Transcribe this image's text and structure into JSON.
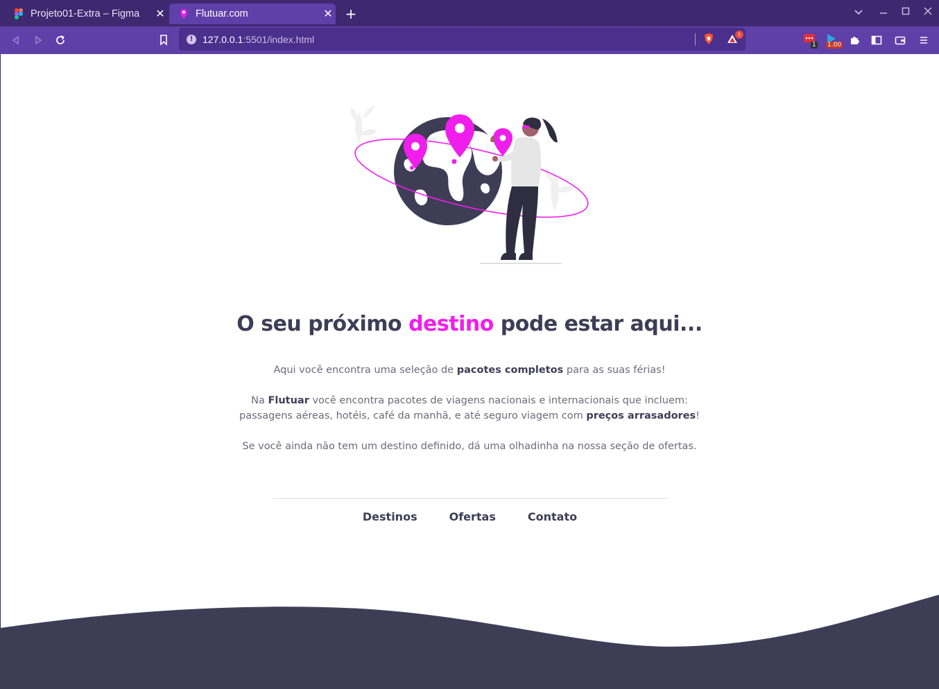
{
  "browser": {
    "tabs": [
      {
        "title": "Projeto01-Extra – Figma",
        "close": "✕",
        "active": false
      },
      {
        "title": "Flutuar.com",
        "close": "✕",
        "active": true
      }
    ],
    "new_tab": "+",
    "window_controls": {
      "dropdown": "⌄",
      "minimize": "–",
      "maximize": "□",
      "close": "✕"
    },
    "url": {
      "host": "127.0.0.1",
      "path": ":5501/index.html"
    },
    "extensions": {
      "alert_badge": "1",
      "ext1_badge": "1",
      "ext2_badge": "1.00"
    },
    "colors": {
      "tabbar": "#3e2870",
      "toolbar": "#5f3fa8",
      "urlbar": "#4a2f8c"
    }
  },
  "page": {
    "headline": {
      "before": "O seu próximo ",
      "accent": "destino",
      "after": " pode estar aqui..."
    },
    "paragraph1": {
      "t1": "Aqui você encontra uma seleção de ",
      "b1": "pacotes completos",
      "t2": " para as suas férias!"
    },
    "paragraph2": {
      "t1": "Na ",
      "b1": "Flutuar",
      "t2": " você encontra pacotes de viagens nacionais e internacionais que incluem:",
      "t3": "passagens aéreas, hotéis, café da manhã, e até seguro viagem com ",
      "b2": "preços arrasadores",
      "t4": "!"
    },
    "paragraph3": "Se você ainda não tem um destino definido, dá uma olhadinha na nossa seção de ofertas.",
    "nav": [
      {
        "label": "Destinos"
      },
      {
        "label": "Ofertas"
      },
      {
        "label": "Contato"
      }
    ],
    "colors": {
      "accent": "#f01eec",
      "dark": "#3f3d56",
      "text": "#6b6b7b",
      "footer": "#3f3d56"
    }
  }
}
